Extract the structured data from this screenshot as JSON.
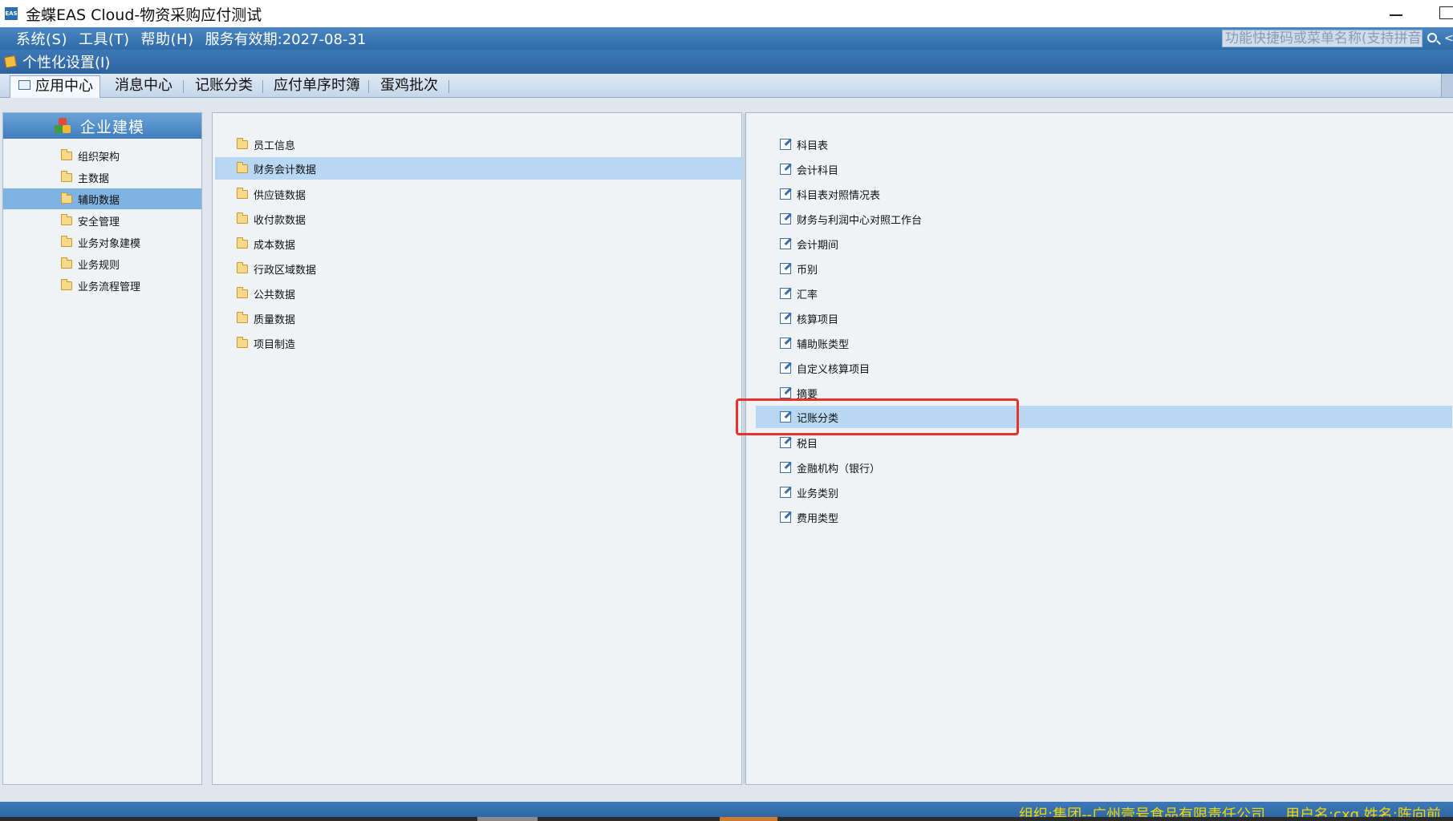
{
  "window": {
    "icon_text": "EAS",
    "title": "金蝶EAS Cloud-物资采购应付测试"
  },
  "menubar": {
    "items": [
      "系统(S)",
      "工具(T)",
      "帮助(H)"
    ],
    "service": "服务有效期:2027-08-31",
    "search_placeholder": "功能快捷码或菜单名称(支持拼音",
    "search_extra": "<"
  },
  "personal": {
    "label": "个性化设置(I)"
  },
  "tabs": [
    {
      "label": "应用中心",
      "active": true
    },
    {
      "label": "消息中心"
    },
    {
      "label": "记账分类"
    },
    {
      "label": "应付单序时簿"
    },
    {
      "label": "蛋鸡批次"
    }
  ],
  "left_panel": {
    "title": "企业建模",
    "items": [
      {
        "label": "组织架构"
      },
      {
        "label": "主数据"
      },
      {
        "label": "辅助数据",
        "selected": true
      },
      {
        "label": "安全管理"
      },
      {
        "label": "业务对象建模"
      },
      {
        "label": "业务规则"
      },
      {
        "label": "业务流程管理"
      }
    ]
  },
  "mid_panel": {
    "items": [
      {
        "label": "员工信息"
      },
      {
        "label": "财务会计数据",
        "selected": true
      },
      {
        "label": "供应链数据"
      },
      {
        "label": "收付款数据"
      },
      {
        "label": "成本数据"
      },
      {
        "label": "行政区域数据"
      },
      {
        "label": "公共数据"
      },
      {
        "label": "质量数据"
      },
      {
        "label": "项目制造"
      }
    ]
  },
  "right_panel": {
    "items": [
      {
        "label": "科目表"
      },
      {
        "label": "会计科目"
      },
      {
        "label": "科目表对照情况表"
      },
      {
        "label": "财务与利润中心对照工作台"
      },
      {
        "label": "会计期间"
      },
      {
        "label": "币别"
      },
      {
        "label": "汇率"
      },
      {
        "label": "核算项目"
      },
      {
        "label": "辅助账类型"
      },
      {
        "label": "自定义核算项目"
      },
      {
        "label": "摘要"
      },
      {
        "label": "记账分类",
        "selected": true
      },
      {
        "label": "税目"
      },
      {
        "label": "金融机构（银行）"
      },
      {
        "label": "业务类别"
      },
      {
        "label": "费用类型"
      }
    ]
  },
  "status": {
    "org": "组织:集团--广州壹号食品有限责任公司",
    "user": "用户名:cxq  姓名:陈向前"
  }
}
